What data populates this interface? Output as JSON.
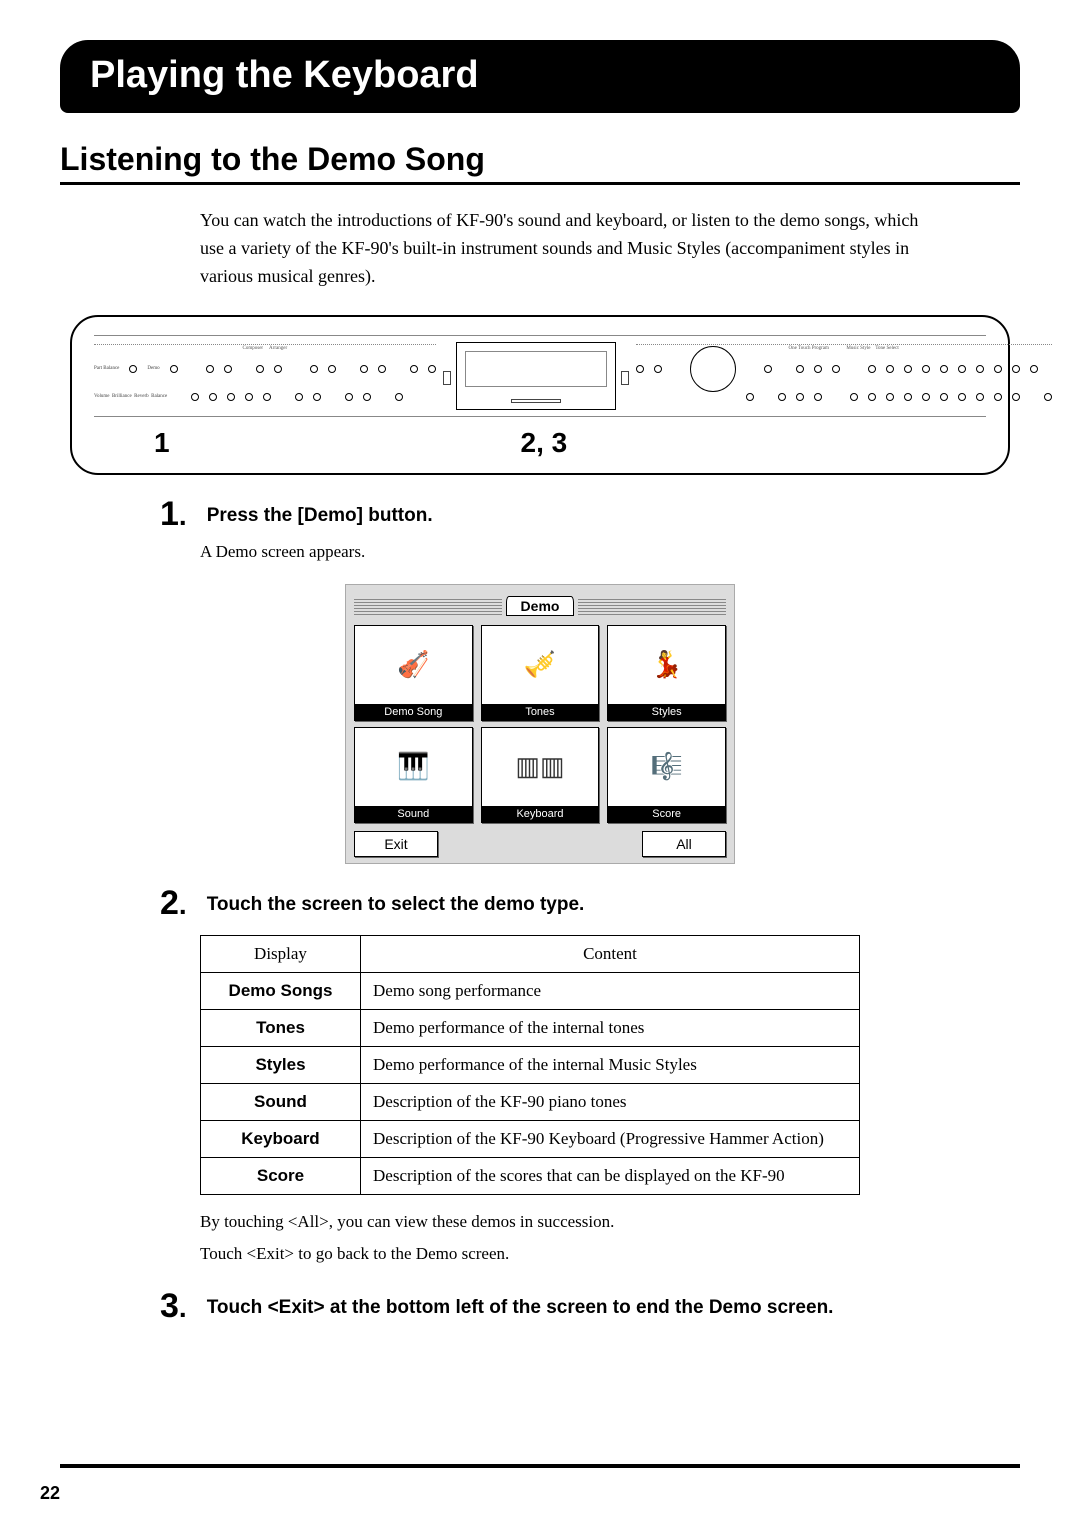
{
  "title": "Playing the Keyboard",
  "subtitle": "Listening to the Demo Song",
  "intro": "You can watch the introductions of KF-90's sound and keyboard, or listen to the demo songs, which use a variety of the KF-90's built-in instrument sounds and Music Styles (accompaniment styles in various musical genres).",
  "panel_labels": {
    "left": "1",
    "center": "2, 3"
  },
  "steps": {
    "s1": {
      "num": "1",
      "title": "Press the [Demo] button.",
      "body": "A Demo screen appears."
    },
    "s2": {
      "num": "2",
      "title": "Touch the screen to select the demo type."
    },
    "s3": {
      "num": "3",
      "title": "Touch <Exit> at the bottom left of the screen to end the Demo screen."
    }
  },
  "demo_screen": {
    "header": "Demo",
    "cells": [
      {
        "label": "Demo Song"
      },
      {
        "label": "Tones"
      },
      {
        "label": "Styles"
      },
      {
        "label": "Sound"
      },
      {
        "label": "Keyboard"
      },
      {
        "label": "Score"
      }
    ],
    "btn_exit": "Exit",
    "btn_all": "All"
  },
  "table": {
    "head": {
      "display": "Display",
      "content": "Content"
    },
    "rows": [
      {
        "display": "Demo Songs",
        "content": "Demo song performance"
      },
      {
        "display": "Tones",
        "content": "Demo performance of the internal tones"
      },
      {
        "display": "Styles",
        "content": "Demo performance of the internal Music Styles"
      },
      {
        "display": "Sound",
        "content": "Description of the KF-90 piano tones"
      },
      {
        "display": "Keyboard",
        "content": "Description of the KF-90 Keyboard (Progressive Hammer Action)"
      },
      {
        "display": "Score",
        "content": "Description of the scores that can be displayed on the KF-90"
      }
    ]
  },
  "after_table_1": "By touching <All>, you can view these demos in succession.",
  "after_table_2": "Touch <Exit> to go back to the Demo screen.",
  "page_number": "22"
}
